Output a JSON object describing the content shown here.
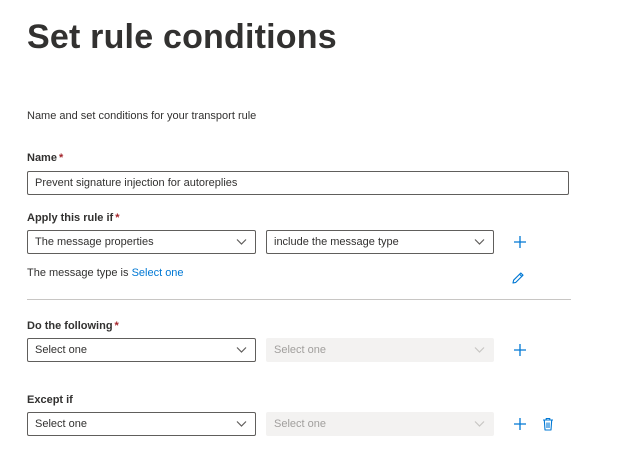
{
  "page": {
    "title": "Set rule conditions",
    "description": "Name and set conditions for your transport rule"
  },
  "name_field": {
    "label": "Name",
    "required_mark": "*",
    "value": "Prevent signature injection for autoreplies"
  },
  "apply_rule": {
    "label": "Apply this rule if",
    "required_mark": "*",
    "condition_dropdown": "The message properties",
    "predicate_dropdown": "include the message type",
    "message_type_prefix": "The message type is",
    "message_type_link": "Select one"
  },
  "do_following": {
    "label": "Do the following",
    "required_mark": "*",
    "action_dropdown": "Select one",
    "action_detail_dropdown": "Select one"
  },
  "except_if": {
    "label": "Except if",
    "exception_dropdown": "Select one",
    "exception_detail_dropdown": "Select one"
  },
  "icons": {
    "add": "plus-icon",
    "edit": "pencil-icon",
    "delete": "trash-icon",
    "dropdown": "chevron-down-icon"
  },
  "colors": {
    "accent": "#0078d4",
    "required": "#a4262c",
    "text": "#323130",
    "disabled_bg": "#f3f2f1"
  }
}
